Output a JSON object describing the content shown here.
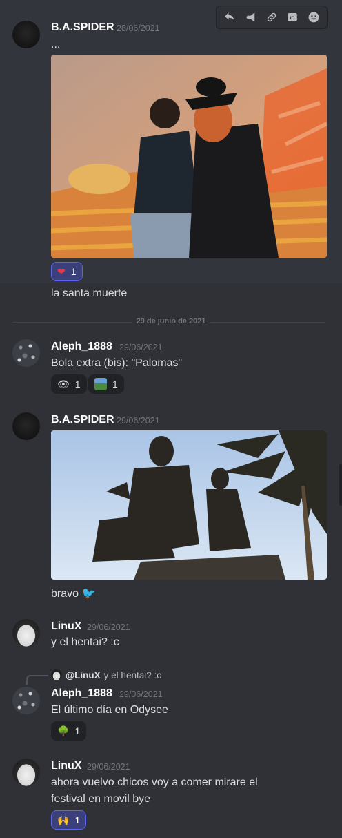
{
  "toolbar": {
    "icons": [
      "reply-icon",
      "pin-icon",
      "link-icon",
      "id-icon",
      "emoji-icon"
    ],
    "id_label": "ID"
  },
  "messages": [
    {
      "username": "B.A.SPIDER",
      "timestamp": "28/06/2021",
      "text": "...",
      "caption": "la santa muerte",
      "reactions": [
        {
          "emoji": "❤️",
          "count": "1"
        }
      ]
    },
    {
      "username": "Aleph_1888",
      "timestamp": "29/06/2021",
      "text": "Bola extra (bis): \"Palomas\"",
      "reactions": [
        {
          "emoji": "👁",
          "count": "1"
        },
        {
          "emoji": "🏞",
          "count": "1"
        }
      ]
    },
    {
      "username": "B.A.SPIDER",
      "timestamp": "29/06/2021",
      "caption": "bravo 🐦"
    },
    {
      "username": "LinuX",
      "timestamp": "29/06/2021",
      "text": "y el hentai? :c"
    },
    {
      "reply_user": "@LinuX",
      "reply_text": "y el hentai? :c",
      "username": "Aleph_1888",
      "timestamp": "29/06/2021",
      "text": "El último día en Odysee",
      "reactions": [
        {
          "emoji": "🌳",
          "count": "1"
        }
      ]
    },
    {
      "username": "LinuX",
      "timestamp": "29/06/2021",
      "text_line1": "ahora vuelvo chicos voy a comer mirare el",
      "text_line2": "festival en movil bye",
      "reactions": [
        {
          "emoji": "🙌",
          "count": "1"
        }
      ]
    }
  ],
  "date_divider": "29 de junio de 2021"
}
